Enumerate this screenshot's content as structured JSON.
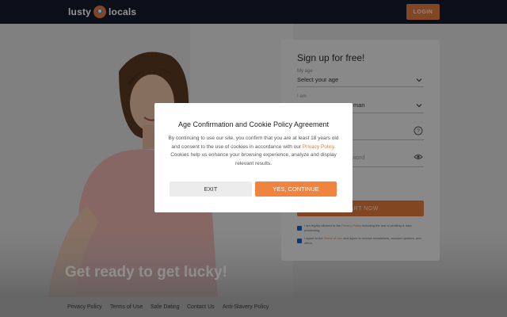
{
  "header": {
    "logo_left": "lusty",
    "logo_right": "locals",
    "login_label": "LOGIN"
  },
  "hero": {
    "tagline": "Get ready to get lucky!"
  },
  "signup": {
    "title": "Sign up for free!",
    "age_label": "My age",
    "age_value": "Select your age",
    "iam_label": "I am",
    "iam_value": "man",
    "password_value": "word",
    "submit_label": "START NOW",
    "check1_text": "I am legally allowed to the",
    "check1_link": "Privacy Policy",
    "check1_tail": "including the use of profiling & data processing.",
    "check2_text": "I agree to the",
    "check2_link": "Terms of Use",
    "check2_tail": "and agree to receive newsletters, account updates, and offers."
  },
  "modal": {
    "title": "Age Confirmation and Cookie Policy Agreement",
    "body_start": "By continuing to use our site, you confirm that you are at least 18 years old and consent to the use of cookies in accordance with our",
    "body_link": "Privacy Policy",
    "body_end": ". Cookies help us enhance your browsing experience, analyze and display relevant results.",
    "exit_label": "EXIT",
    "continue_label": "YES, CONTINUE"
  },
  "footer": {
    "links": [
      "Privacy Policy",
      "Terms of Use",
      "Safe Dating",
      "Contact Us",
      "Anti-Slavery Policy"
    ]
  },
  "colors": {
    "header_bg": "#131a2e",
    "accent": "#f0843f",
    "checkbox": "#1f5fbf"
  }
}
